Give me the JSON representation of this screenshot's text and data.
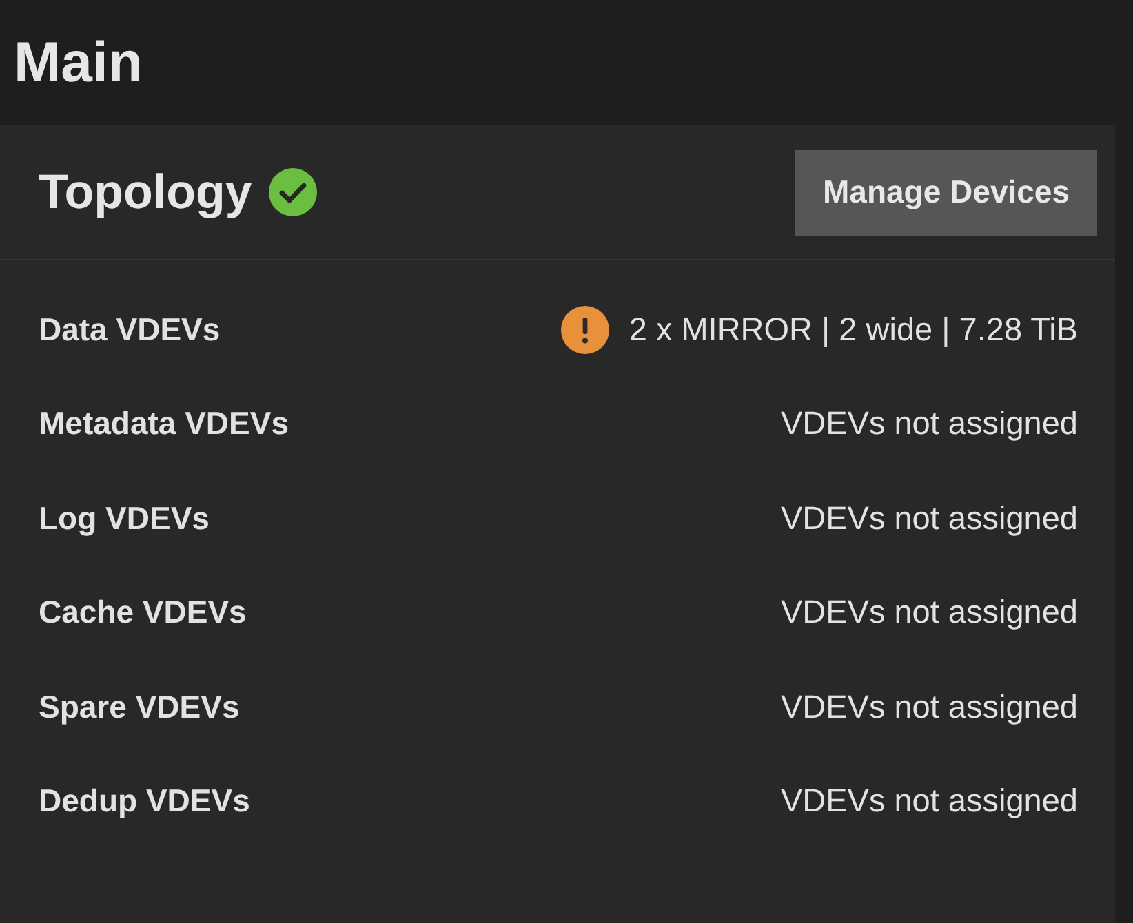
{
  "page": {
    "title": "Main"
  },
  "topology": {
    "title": "Topology",
    "healthy": true,
    "button": "Manage Devices",
    "rows": [
      {
        "label": "Data VDEVs",
        "value": "2 x MIRROR | 2 wide | 7.28 TiB",
        "warning": true
      },
      {
        "label": "Metadata VDEVs",
        "value": "VDEVs not assigned",
        "warning": false
      },
      {
        "label": "Log VDEVs",
        "value": "VDEVs not assigned",
        "warning": false
      },
      {
        "label": "Cache VDEVs",
        "value": "VDEVs not assigned",
        "warning": false
      },
      {
        "label": "Spare VDEVs",
        "value": "VDEVs not assigned",
        "warning": false
      },
      {
        "label": "Dedup VDEVs",
        "value": "VDEVs not assigned",
        "warning": false
      }
    ]
  }
}
